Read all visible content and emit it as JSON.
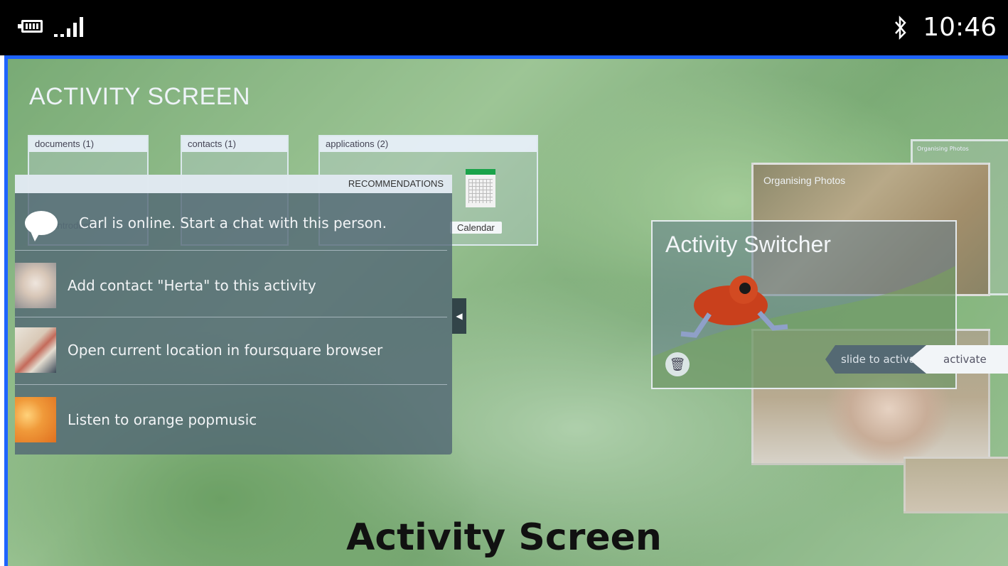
{
  "status_bar": {
    "battery_icon": "battery-icon",
    "signal_icon": "signal-icon",
    "bluetooth_icon": "bluetooth-icon",
    "time": "10:46"
  },
  "screen": {
    "title": "ACTIVITY SCREEN",
    "groups": [
      {
        "label": "documents (1)"
      },
      {
        "label": "contacts (1)"
      },
      {
        "label": "applications (2)",
        "app_label": "Calendar"
      }
    ],
    "recommendations": {
      "header": "RECOMMENDATIONS",
      "items": [
        {
          "text": "Carl is online. Start a chat with this person.",
          "icon": "chat-bubble-icon"
        },
        {
          "text": "Add contact \"Herta\" to this activity",
          "icon": "contact-photo"
        },
        {
          "text": "Open current location in foursquare browser",
          "icon": "map-thumbnail"
        },
        {
          "text": "Listen to orange popmusic",
          "icon": "orange-thumbnail"
        }
      ],
      "collapse_icon": "chevron-left-icon"
    },
    "switcher": {
      "title": "Activity Switcher",
      "back_card_title": "Organising Photos",
      "tiny_card_title": "Organising Photos",
      "slide_label": "slide to activate",
      "activate_label": "activate",
      "trash_icon": "trash-icon"
    },
    "caption": "Activity Screen"
  }
}
